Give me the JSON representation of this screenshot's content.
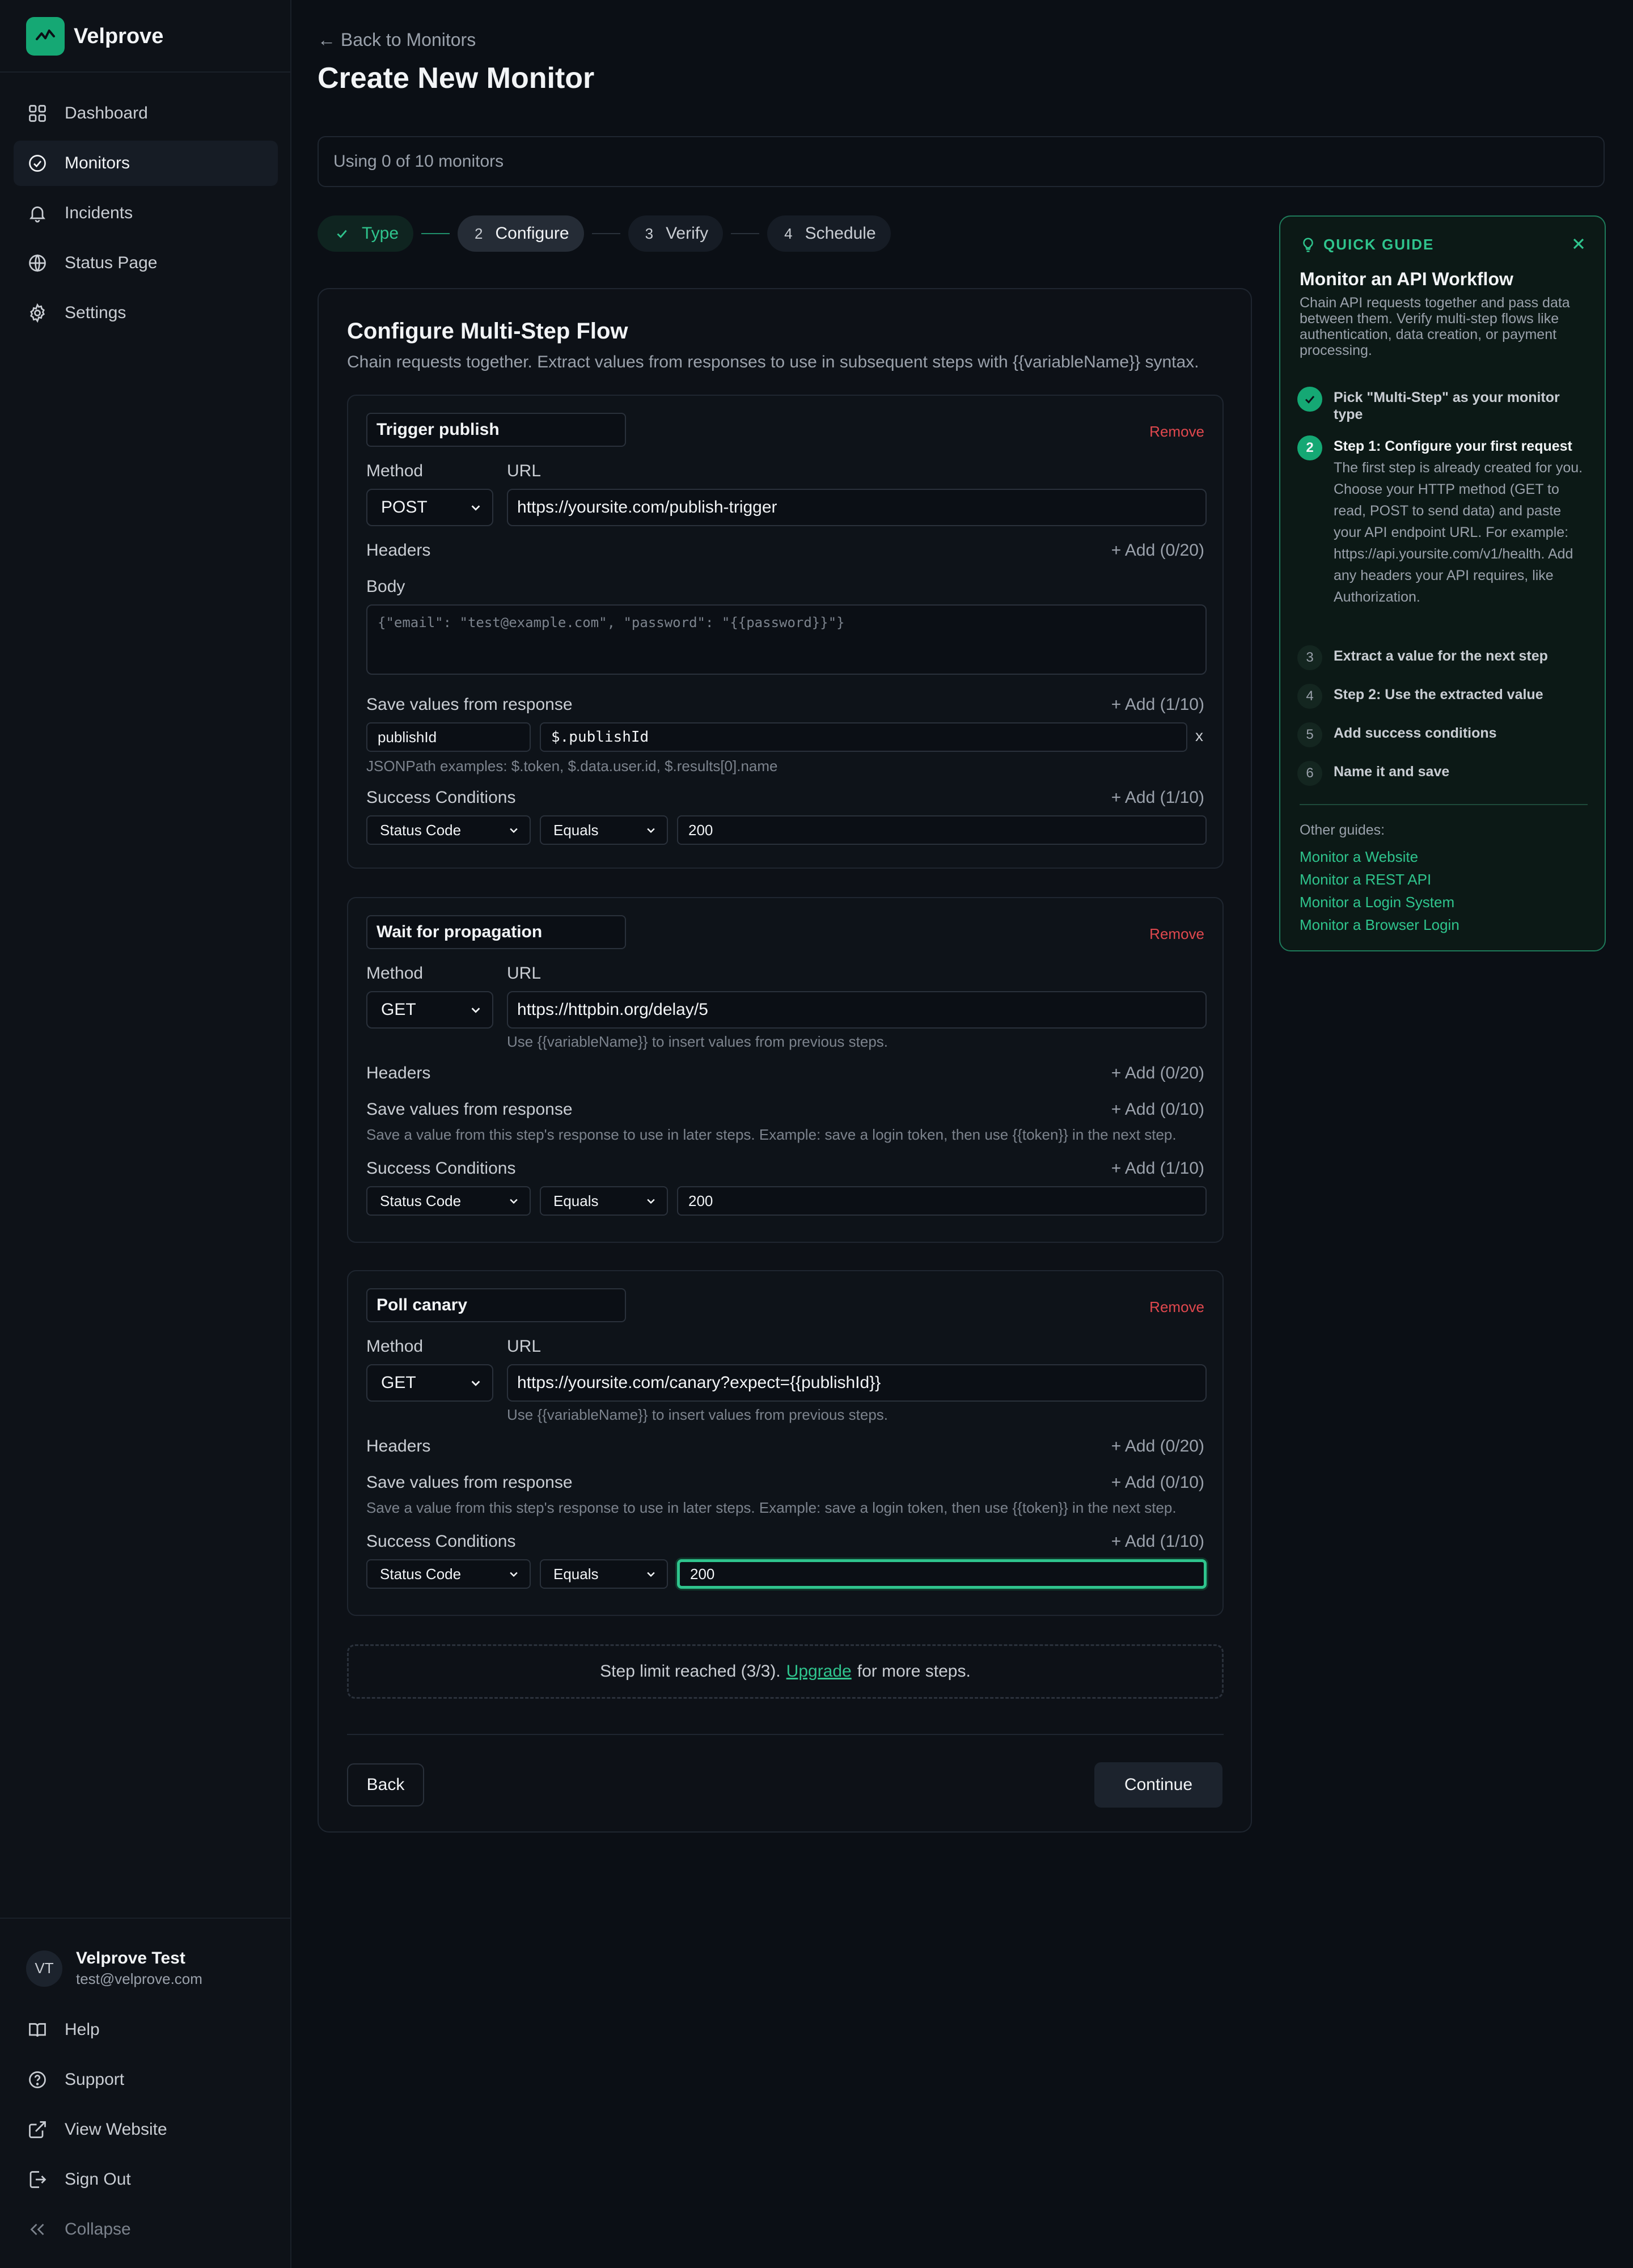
{
  "app": {
    "name": "Velprove"
  },
  "sidebar": {
    "items": [
      {
        "label": "Dashboard",
        "icon": "grid-icon"
      },
      {
        "label": "Monitors",
        "icon": "check-circle-icon",
        "active": true
      },
      {
        "label": "Incidents",
        "icon": "bell-icon"
      },
      {
        "label": "Status Page",
        "icon": "globe-icon"
      },
      {
        "label": "Settings",
        "icon": "gear-icon"
      }
    ],
    "user": {
      "initials": "VT",
      "name": "Velprove Test",
      "email": "test@velprove.com"
    },
    "bottom": [
      {
        "label": "Help",
        "icon": "book-icon"
      },
      {
        "label": "Support",
        "icon": "help-circle-icon"
      },
      {
        "label": "View Website",
        "icon": "external-link-icon"
      },
      {
        "label": "Sign Out",
        "icon": "sign-out-icon"
      },
      {
        "label": "Collapse",
        "icon": "collapse-icon"
      }
    ]
  },
  "header": {
    "back": "← Back to Monitors",
    "title": "Create New Monitor"
  },
  "usage": "Using 0 of 10 monitors",
  "stepper": [
    {
      "num": "✓",
      "label": "Type",
      "state": "done"
    },
    {
      "num": "2",
      "label": "Configure",
      "state": "current"
    },
    {
      "num": "3",
      "label": "Verify",
      "state": "upcoming"
    },
    {
      "num": "4",
      "label": "Schedule",
      "state": "upcoming"
    }
  ],
  "form": {
    "title": "Configure Multi-Step Flow",
    "description": "Chain requests together. Extract values from responses to use in subsequent steps with {{variableName}} syntax.",
    "labels": {
      "method": "Method",
      "url": "URL",
      "headers": "Headers",
      "body": "Body",
      "save_values": "Save values from response",
      "success": "Success Conditions",
      "remove": "Remove"
    },
    "steps": [
      {
        "name": "Trigger publish",
        "method": "POST",
        "url": "https://yoursite.com/publish-trigger",
        "headers_add": "+ Add (0/20)",
        "body_placeholder": "{\"email\": \"test@example.com\", \"password\": \"{{password}}\"}",
        "save_add": "+ Add (1/10)",
        "extract_name": "publishId",
        "extract_path": "$.publishId",
        "extract_remove": "x",
        "jsonpath_hint": "JSONPath examples: $.token, $.data.user.id, $.results[0].name",
        "success_add": "+ Add (1/10)",
        "cond_type": "Status Code",
        "cond_op": "Equals",
        "cond_value": "200"
      },
      {
        "name": "Wait for propagation",
        "method": "GET",
        "url": "https://httpbin.org/delay/5",
        "url_hint": "Use {{variableName}} to insert values from previous steps.",
        "headers_add": "+ Add (0/20)",
        "save_add": "+ Add (0/10)",
        "save_hint": "Save a value from this step's response to use in later steps. Example: save a login token, then use {{token}} in the next step.",
        "success_add": "+ Add (1/10)",
        "cond_type": "Status Code",
        "cond_op": "Equals",
        "cond_value": "200"
      },
      {
        "name": "Poll canary",
        "method": "GET",
        "url": "https://yoursite.com/canary?expect={{publishId}}",
        "url_hint": "Use {{variableName}} to insert values from previous steps.",
        "headers_add": "+ Add (0/20)",
        "save_add": "+ Add (0/10)",
        "save_hint": "Save a value from this step's response to use in later steps. Example: save a login token, then use {{token}} in the next step.",
        "success_add": "+ Add (1/10)",
        "cond_type": "Status Code",
        "cond_op": "Equals",
        "cond_value": "200"
      }
    ],
    "limit": {
      "before": "Step limit reached (3/3).",
      "link": "Upgrade",
      "after": "for more steps."
    },
    "back": "Back",
    "continue": "Continue"
  },
  "guide": {
    "badge": "QUICK GUIDE",
    "title": "Monitor an API Workflow",
    "description": "Chain API requests together and pass data between them. Verify multi-step flows like authentication, data creation, or payment processing.",
    "steps": [
      {
        "num": "✓",
        "text": "Pick \"Multi-Step\" as your monitor type"
      },
      {
        "num": "2",
        "text": "Step 1: Configure your first request",
        "detail": "The first step is already created for you. Choose your HTTP method (GET to read, POST to send data) and paste your API endpoint URL. For example: https://api.yoursite.com/v1/health. Add any headers your API requires, like Authorization."
      },
      {
        "num": "3",
        "text": "Extract a value for the next step"
      },
      {
        "num": "4",
        "text": "Step 2: Use the extracted value"
      },
      {
        "num": "5",
        "text": "Add success conditions"
      },
      {
        "num": "6",
        "text": "Name it and save"
      }
    ],
    "other_label": "Other guides:",
    "links": [
      "Monitor a Website",
      "Monitor a REST API",
      "Monitor a Login System",
      "Monitor a Browser Login"
    ]
  },
  "colors": {
    "accent": "#2fc48d",
    "danger": "#e0484e",
    "background": "#0b0f15"
  }
}
